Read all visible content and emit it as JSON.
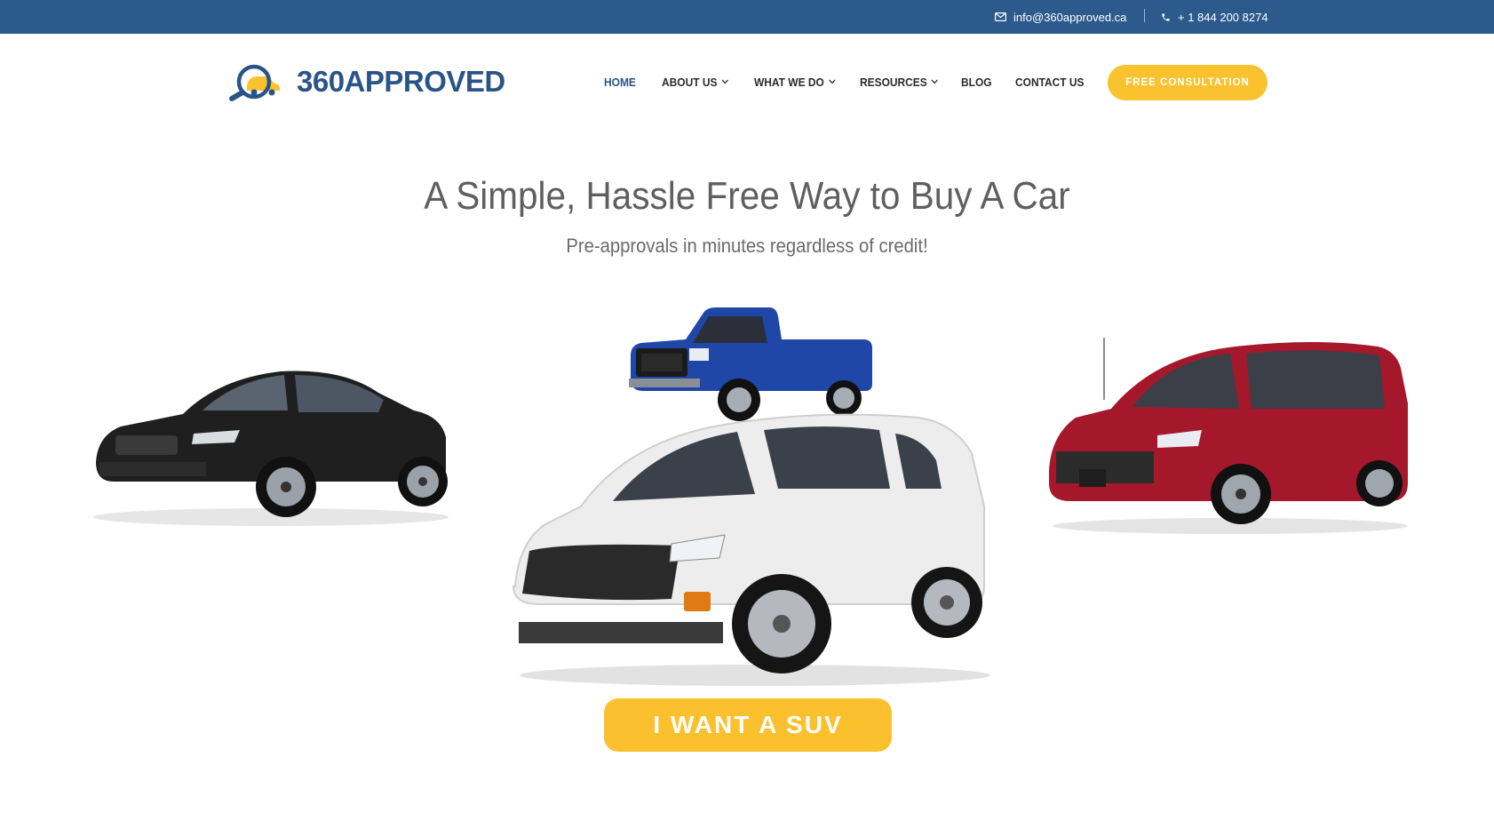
{
  "topbar": {
    "email": "info@360approved.ca",
    "phone": "+ 1 844 200 8274",
    "email_icon": "envelope-icon",
    "phone_icon": "phone-icon"
  },
  "brand": {
    "name": "360APPROVED",
    "logo_icon": "magnifier-car-logo",
    "colors": {
      "primary": "#2a5487",
      "accent": "#f9c22e",
      "topbar": "#2c5a8c"
    }
  },
  "nav": {
    "items": [
      {
        "label": "HOME",
        "active": true,
        "dropdown": false
      },
      {
        "label": "ABOUT US",
        "active": false,
        "dropdown": true
      },
      {
        "label": "WHAT WE DO",
        "active": false,
        "dropdown": true
      },
      {
        "label": "RESOURCES",
        "active": false,
        "dropdown": true
      },
      {
        "label": "BLOG",
        "active": false,
        "dropdown": false
      },
      {
        "label": "CONTACT US",
        "active": false,
        "dropdown": false
      }
    ],
    "cta": "FREE CONSULTATION"
  },
  "hero": {
    "title": "A Simple, Hassle Free Way to Buy A Car",
    "subtitle": "Pre-approvals in minutes regardless of credit!",
    "vehicles": [
      {
        "type": "sedan",
        "color": "#1e1e1e"
      },
      {
        "type": "pickup-truck",
        "color": "#1f47a8"
      },
      {
        "type": "suv",
        "color": "#e9e9e9"
      },
      {
        "type": "minivan",
        "color": "#a5182b"
      }
    ],
    "cta": "I WANT A SUV"
  }
}
